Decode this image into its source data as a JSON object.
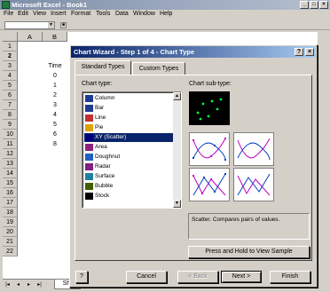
{
  "window": {
    "title": "Microsoft Excel - Book1",
    "controls": [
      "_",
      "□",
      "×"
    ]
  },
  "menu": {
    "items": [
      "File",
      "Edit",
      "View",
      "Insert",
      "Format",
      "Tools",
      "Data",
      "Window",
      "Help"
    ]
  },
  "sheet": {
    "columns": [
      "A",
      "B"
    ],
    "rows": [
      "1",
      "2",
      "3",
      "4",
      "5",
      "6",
      "7",
      "8",
      "9",
      "10",
      "11",
      "12",
      "13",
      "14",
      "15",
      "16",
      "17",
      "18",
      "19",
      "20",
      "21",
      "22"
    ],
    "b_values": [
      "Time",
      "0",
      "1",
      "2",
      "3",
      "4",
      "5",
      "6",
      "8"
    ],
    "tab_label": "She"
  },
  "dialog": {
    "title": "Chart Wizard - Step 1 of 4 - Chart Type",
    "help_button": "?",
    "close_button": "×",
    "tabs": [
      "Standard Types",
      "Custom Types"
    ],
    "chart_type_label": "Chart type:",
    "chart_types": [
      {
        "label": "Column",
        "icon": "column-chart-icon",
        "color": "#1f3a93"
      },
      {
        "label": "Bar",
        "icon": "bar-chart-icon",
        "color": "#1f3a93"
      },
      {
        "label": "Line",
        "icon": "line-chart-icon",
        "color": "#c03030"
      },
      {
        "label": "Pie",
        "icon": "pie-chart-icon",
        "color": "#e0a000"
      },
      {
        "label": "XY (Scatter)",
        "icon": "scatter-chart-icon",
        "color": "#000080"
      },
      {
        "label": "Area",
        "icon": "area-chart-icon",
        "color": "#902080"
      },
      {
        "label": "Doughnut",
        "icon": "doughnut-chart-icon",
        "color": "#2060c0"
      },
      {
        "label": "Radar",
        "icon": "radar-chart-icon",
        "color": "#802080"
      },
      {
        "label": "Surface",
        "icon": "surface-chart-icon",
        "color": "#2080a0"
      },
      {
        "label": "Bubble",
        "icon": "bubble-chart-icon",
        "color": "#406000"
      },
      {
        "label": "Stock",
        "icon": "stock-chart-icon",
        "color": "#000000"
      }
    ],
    "selected_index": 4,
    "subtype_label": "Chart sub-type:",
    "description": "Scatter. Compares pairs of values.",
    "preview_button": "Press and Hold to View Sample",
    "buttons": {
      "cancel": "Cancel",
      "back": "< Back",
      "next": "Next >",
      "finish": "Finish"
    },
    "accent_color": "#0a246a"
  }
}
